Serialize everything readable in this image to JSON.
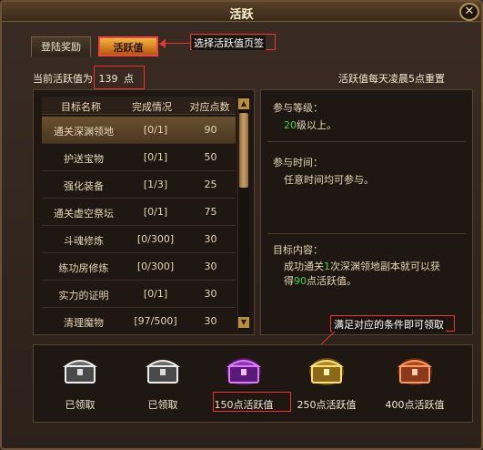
{
  "window": {
    "title": "活跃",
    "close_symbol": "✕"
  },
  "tabs": [
    {
      "label": "登陆奖励",
      "active": false
    },
    {
      "label": "活跃值",
      "active": true
    }
  ],
  "annotations": {
    "tab_hint": "选择活跃值页签",
    "reward_hint": "满足对应的条件即可领取"
  },
  "status": {
    "current_prefix": "当前活跃值为",
    "current_value": "139",
    "current_suffix": "点",
    "reset_note": "活跃值每天凌晨5点重置"
  },
  "table": {
    "columns": [
      "目标名称",
      "完成情况",
      "对应点数"
    ],
    "rows": [
      {
        "name": "通关深渊领地",
        "progress": "[0/1]",
        "points": "90",
        "selected": true
      },
      {
        "name": "护送宝物",
        "progress": "[0/1]",
        "points": "50"
      },
      {
        "name": "强化装备",
        "progress": "[1/3]",
        "points": "25"
      },
      {
        "name": "通关虚空祭坛",
        "progress": "[0/1]",
        "points": "75"
      },
      {
        "name": "斗魂修炼",
        "progress": "[0/300]",
        "points": "30"
      },
      {
        "name": "练功房修炼",
        "progress": "[0/300]",
        "points": "30"
      },
      {
        "name": "实力的证明",
        "progress": "[0/1]",
        "points": "30"
      },
      {
        "name": "清理魔物",
        "progress": "[97/500]",
        "points": "30"
      }
    ]
  },
  "details": {
    "level_label": "参与等级：",
    "level_value": "20",
    "level_suffix": "级以上。",
    "time_label": "参与时间：",
    "time_value": "任意时间均可参与。",
    "goal_label": "目标内容：",
    "goal_line1_a": "成功通关",
    "goal_line1_num": "1",
    "goal_line1_b": "次深渊领地副本就可以获",
    "goal_line2_a": "得",
    "goal_line2_num": "90",
    "goal_line2_b": "点活跃值。"
  },
  "rewards": [
    {
      "label": "已领取",
      "color": "#d8d8d8"
    },
    {
      "label": "已领取",
      "color": "#d8d8d8"
    },
    {
      "label": "150点活跃值",
      "color": "#b050e0"
    },
    {
      "label": "250点活跃值",
      "color": "#e8c040"
    },
    {
      "label": "400点活跃值",
      "color": "#e06030"
    }
  ]
}
